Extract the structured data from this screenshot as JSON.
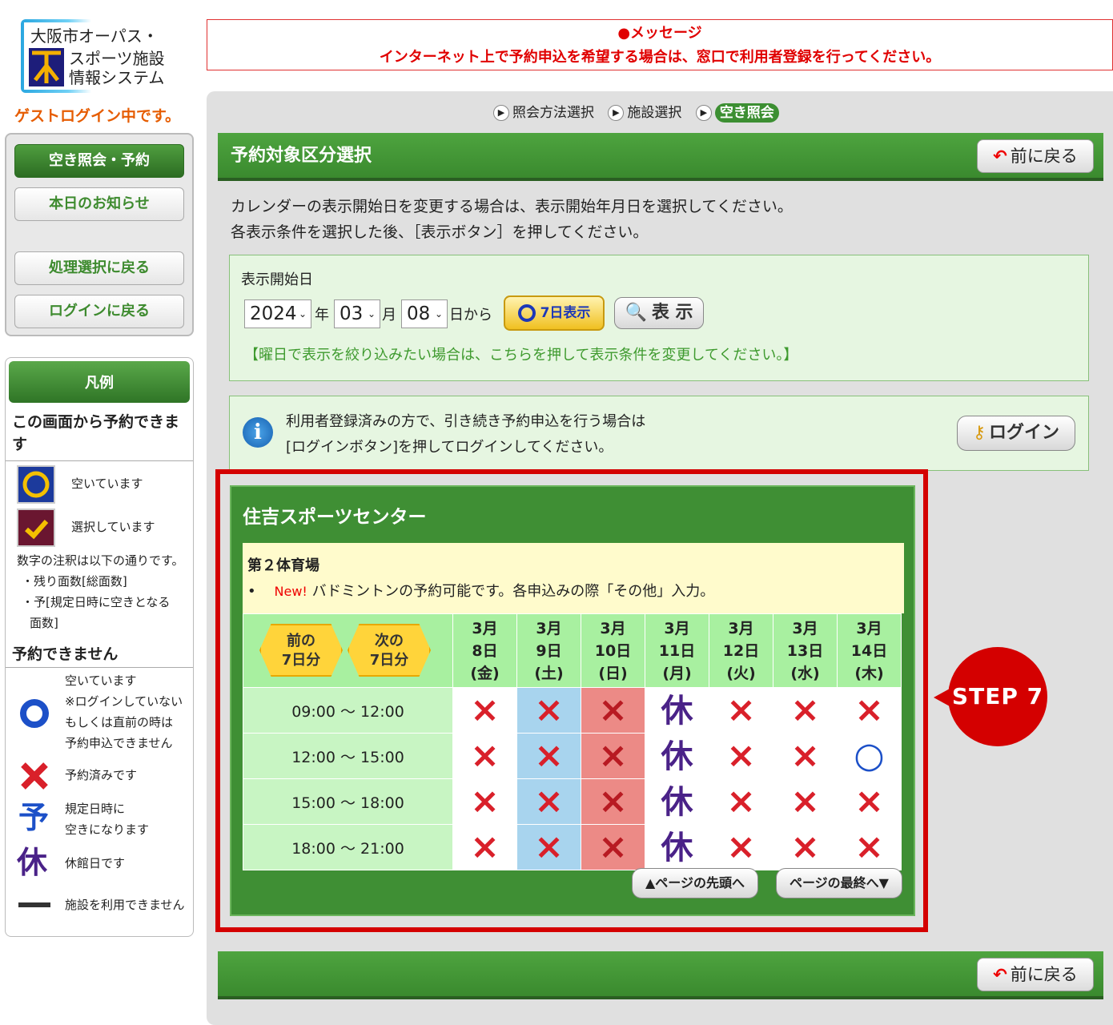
{
  "logo": {
    "line1": "大阪市オーパス・",
    "mark": "",
    "line2": "スポーツ施設",
    "line3": "情報システム"
  },
  "guest_status": "ゲストログイン中です。",
  "menu": {
    "items": [
      "空き照会・予約",
      "本日のお知らせ",
      "処理選択に戻る",
      "ログインに戻る"
    ]
  },
  "legend": {
    "title": "凡例",
    "can_reserve_heading": "この画面から予約できます",
    "available": "空いています",
    "selected": "選択しています",
    "note_intro": "数字の注釈は以下の通りです。",
    "note_1": "・残り面数[総面数]",
    "note_2": "・予[規定日時に空きとなる",
    "note_3": "面数]",
    "cannot_reserve_heading": "予約できません",
    "open_circle": [
      "空いています",
      "※ログインしていない",
      "もしくは直前の時は",
      "予約申込できません"
    ],
    "reserved": "予約済みです",
    "pending": [
      "規定日時に",
      "空きになります"
    ],
    "closed": "休館日です",
    "unavailable": "施設を利用できません",
    "icons": {
      "pending": "予",
      "closed": "休"
    }
  },
  "message": {
    "title": "●メッセージ",
    "body": "インターネット上で予約申込を希望する場合は、窓口で利用者登録を行ってください。"
  },
  "breadcrumb": [
    "照会方法選択",
    "施設選択",
    "空き照会"
  ],
  "section_title": "予約対象区分選択",
  "back_label": "前に戻る",
  "instructions": [
    "カレンダーの表示開始日を変更する場合は、表示開始年月日を選択してください。",
    "各表示条件を選択した後、［表示ボタン］を押してください。"
  ],
  "date_select": {
    "label": "表示開始日",
    "year": "2024",
    "year_unit": "年",
    "month": "03",
    "month_unit": "月",
    "day": "08",
    "day_unit": "日から",
    "seven_day_label": "7日表示",
    "show_label": "表 示",
    "weekday_hint": "【曜日で表示を絞り込みたい場合は、こちらを押して表示条件を変更してください。】"
  },
  "login_info": {
    "line1": "利用者登録済みの方で、引き続き予約申込を行う場合は",
    "line2": "[ログインボタン]を押してログインしてください。",
    "button": "ログイン",
    "icon": "i"
  },
  "facility": {
    "name": "住吉スポーツセンター",
    "room": "第２体育場",
    "new_badge": "New!",
    "note": "バドミントンの予約可能です。各申込みの際「その他」入力。",
    "prev_label": [
      "前の",
      "7日分"
    ],
    "next_label": [
      "次の",
      "7日分"
    ],
    "days": [
      {
        "month": "3月",
        "day": "8日",
        "dow": "(金)"
      },
      {
        "month": "3月",
        "day": "9日",
        "dow": "(土)"
      },
      {
        "month": "3月",
        "day": "10日",
        "dow": "(日)"
      },
      {
        "month": "3月",
        "day": "11日",
        "dow": "(月)"
      },
      {
        "month": "3月",
        "day": "12日",
        "dow": "(火)"
      },
      {
        "month": "3月",
        "day": "13日",
        "dow": "(水)"
      },
      {
        "month": "3月",
        "day": "14日",
        "dow": "(木)"
      }
    ],
    "slots": [
      {
        "time": "09:00 ～ 12:00",
        "status": [
          "×",
          "×",
          "×",
          "休",
          "×",
          "×",
          "×"
        ]
      },
      {
        "time": "12:00 ～ 15:00",
        "status": [
          "×",
          "×",
          "×",
          "休",
          "×",
          "×",
          "○"
        ]
      },
      {
        "time": "15:00 ～ 18:00",
        "status": [
          "×",
          "×",
          "×",
          "休",
          "×",
          "×",
          "×"
        ]
      },
      {
        "time": "18:00 ～ 21:00",
        "status": [
          "×",
          "×",
          "×",
          "休",
          "×",
          "×",
          "×"
        ]
      }
    ],
    "page_top": "▲ページの先頭へ",
    "page_bottom": "ページの最終へ▼"
  },
  "step_badge": "STEP 7",
  "colors": {
    "accent_green": "#3f8f34",
    "highlight_red": "#d40000",
    "message_red": "#e00000",
    "guest_orange": "#e65c00"
  }
}
